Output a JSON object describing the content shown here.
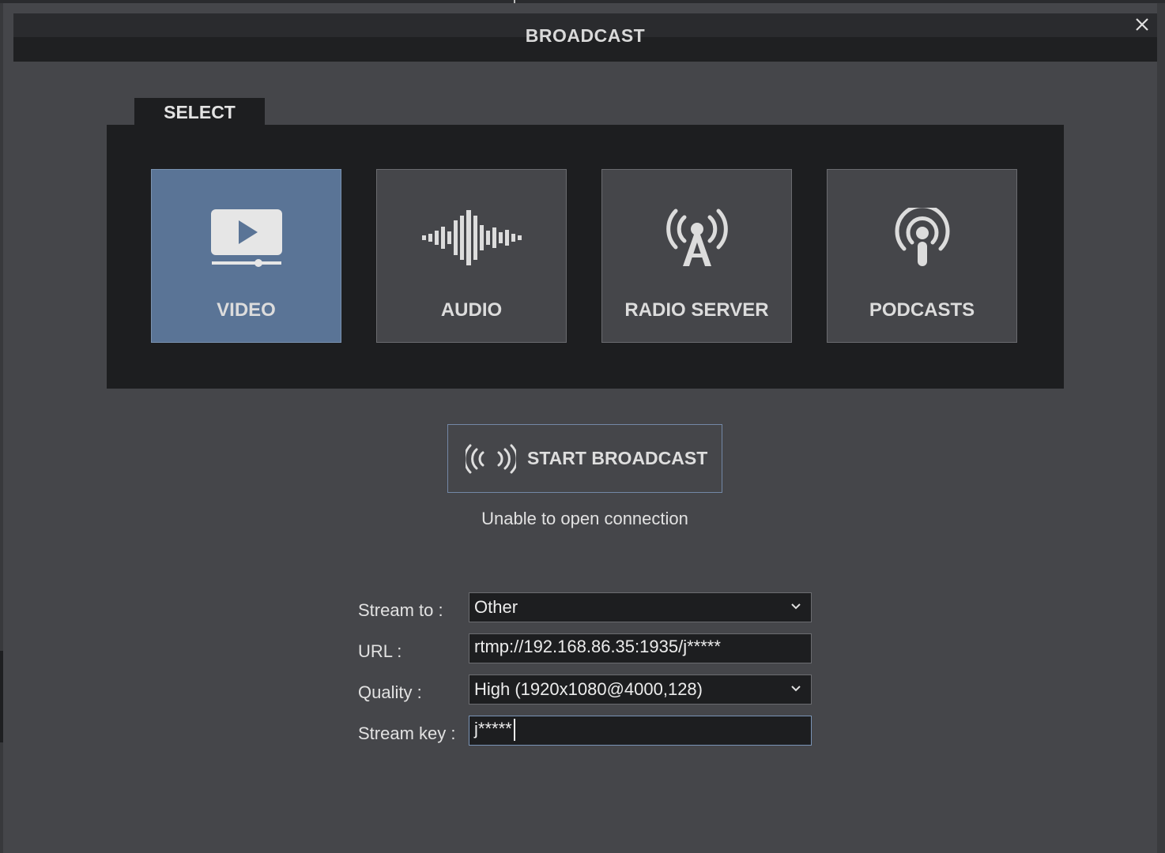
{
  "dialog": {
    "title": "BROADCAST"
  },
  "select": {
    "tab_label": "SELECT",
    "options": [
      {
        "label": "VIDEO",
        "icon": "video-play-icon",
        "selected": true
      },
      {
        "label": "AUDIO",
        "icon": "audio-waveform-icon",
        "selected": false
      },
      {
        "label": "RADIO SERVER",
        "icon": "radio-tower-icon",
        "selected": false
      },
      {
        "label": "PODCASTS",
        "icon": "podcast-icon",
        "selected": false
      }
    ]
  },
  "broadcast": {
    "button_label": "START BROADCAST",
    "icon": "broadcast-waves-icon",
    "status": "Unable to open connection"
  },
  "form": {
    "stream_to": {
      "label": "Stream to :",
      "value": "Other"
    },
    "url": {
      "label": "URL :",
      "value": "rtmp://192.168.86.35:1935/j*****"
    },
    "quality": {
      "label": "Quality :",
      "value": "High (1920x1080@4000,128)"
    },
    "stream_key": {
      "label": "Stream key :",
      "value": "j*****"
    }
  },
  "colors": {
    "background": "#45464a",
    "panel": "#1d1e20",
    "selected_tile": "#5a7496",
    "accent_border": "#7388a6"
  }
}
